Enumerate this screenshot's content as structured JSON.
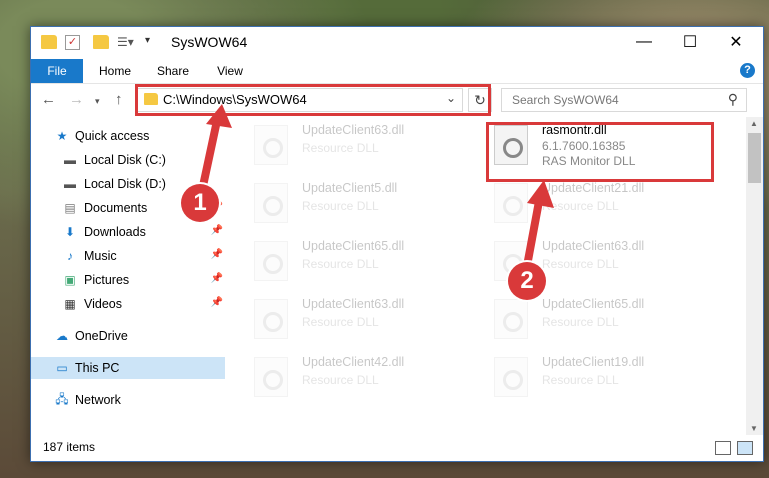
{
  "window": {
    "title": "SysWOW64"
  },
  "ribbon": {
    "tabs": [
      "File",
      "Home",
      "Share",
      "View"
    ],
    "help": "?"
  },
  "nav": {
    "path": "C:\\Windows\\SysWOW64",
    "search_placeholder": "Search SysWOW64"
  },
  "sidebar": {
    "items": [
      {
        "label": "Quick access",
        "icon": "star-icon"
      },
      {
        "label": "Local Disk (C:)",
        "icon": "drive-icon",
        "pinned": true
      },
      {
        "label": "Local Disk (D:)",
        "icon": "drive-icon",
        "pinned": true
      },
      {
        "label": "Documents",
        "icon": "document-icon",
        "pinned": true
      },
      {
        "label": "Downloads",
        "icon": "download-icon",
        "pinned": true
      },
      {
        "label": "Music",
        "icon": "music-icon",
        "pinned": true
      },
      {
        "label": "Pictures",
        "icon": "pictures-icon",
        "pinned": true
      },
      {
        "label": "Videos",
        "icon": "videos-icon",
        "pinned": true
      },
      {
        "label": "OneDrive",
        "icon": "cloud-icon"
      },
      {
        "label": "This PC",
        "icon": "computer-icon",
        "selected": true
      },
      {
        "label": "Network",
        "icon": "network-icon"
      }
    ]
  },
  "files": {
    "left": [
      {
        "name": "UpdateClient63.dll",
        "desc": "Resource DLL"
      },
      {
        "name": "UpdateClient5.dll",
        "desc": "Resource DLL"
      },
      {
        "name": "UpdateClient65.dll",
        "desc": "Resource DLL"
      },
      {
        "name": "UpdateClient63.dll",
        "desc": "Resource DLL"
      },
      {
        "name": "UpdateClient42.dll",
        "desc": "Resource DLL"
      }
    ],
    "highlight": {
      "name": "rasmontr.dll",
      "version": "6.1.7600.16385",
      "desc": "RAS Monitor DLL"
    },
    "right": [
      {
        "name": "UpdateClient21.dll",
        "desc": "Resource DLL"
      },
      {
        "name": "UpdateClient63.dll",
        "desc": "Resource DLL"
      },
      {
        "name": "UpdateClient65.dll",
        "desc": "Resource DLL"
      },
      {
        "name": "UpdateClient19.dll",
        "desc": "Resource DLL"
      }
    ]
  },
  "status": {
    "count": "187 items"
  },
  "annotations": {
    "badge1": "1",
    "badge2": "2",
    "color": "#d9393a"
  }
}
